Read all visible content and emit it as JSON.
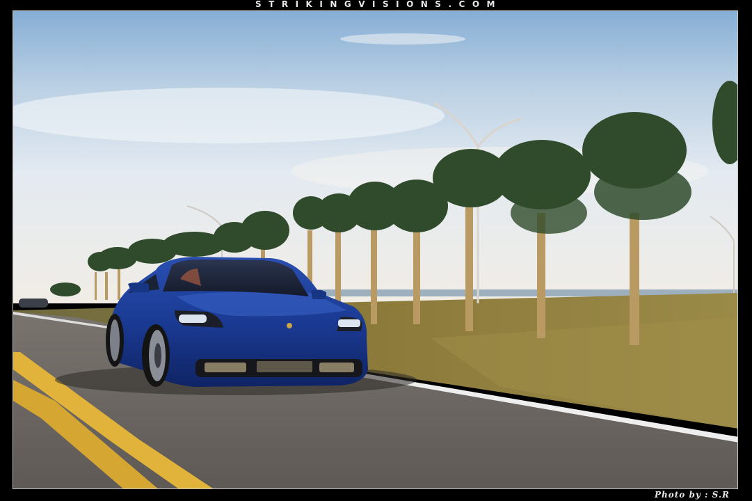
{
  "header": {
    "watermark_text": "STRIKINGVISIONS.COM"
  },
  "footer": {
    "credit_text": "Photo by : S.R"
  },
  "photo": {
    "subject": "blue-sports-sedan",
    "scene": "road-with-palm-trees",
    "colors": {
      "frame": "#000000",
      "sky_top": "#8fb3d6",
      "sky_low": "#e9eef3",
      "car": "#1d3f9a",
      "grass": "#8a7a3c",
      "road": "#6f6a66",
      "lane_yellow": "#e2b33a"
    }
  }
}
